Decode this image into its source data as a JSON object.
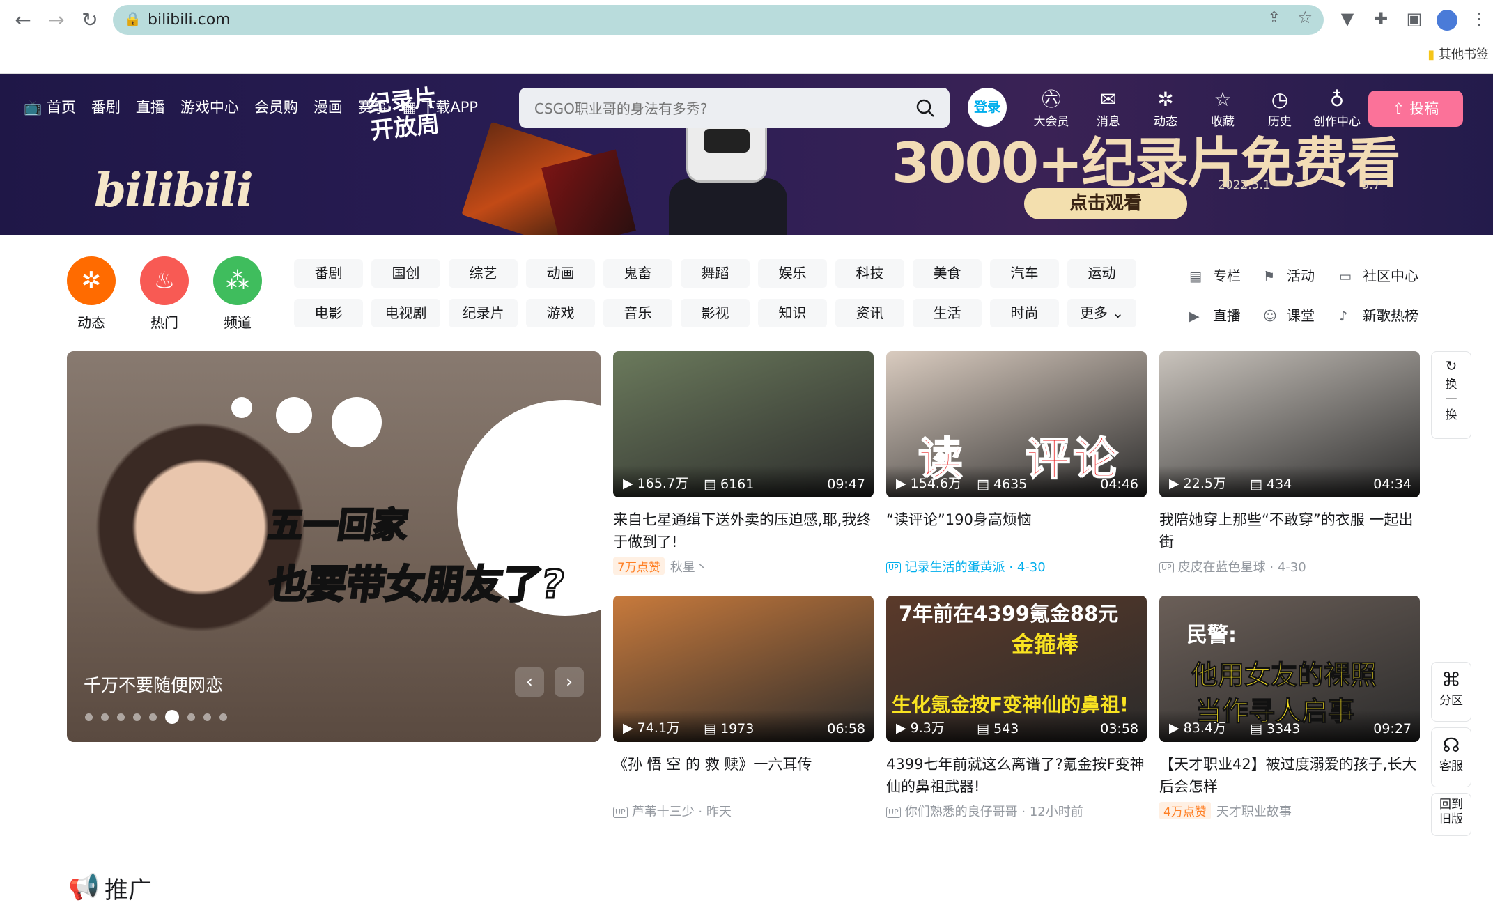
{
  "browser": {
    "url": "bilibili.com",
    "bookmark": "其他书签"
  },
  "header": {
    "nav": [
      "首页",
      "番剧",
      "直播",
      "游戏中心",
      "会员购",
      "漫画",
      "赛事",
      "下载APP"
    ],
    "search_placeholder": "CSGO职业哥的身法有多秀?",
    "login": "登录",
    "user_items": [
      "大会员",
      "消息",
      "动态",
      "收藏",
      "历史",
      "创作中心"
    ],
    "upload": "投稿"
  },
  "banner": {
    "logo": "bilibili",
    "subtitle": "纪录片\n开放周",
    "headline": "3000+纪录片免费看",
    "date_start": "2022.5.1",
    "date_end": "5.7",
    "cta": "点击观看"
  },
  "channels": {
    "shortcuts": [
      {
        "label": "动态",
        "color": "#ff6b00",
        "icon": "pinwheel-icon"
      },
      {
        "label": "热门",
        "color": "#f85a54",
        "icon": "fire-icon"
      },
      {
        "label": "频道",
        "color": "#3fbd5d",
        "icon": "channel-icon"
      }
    ],
    "row1": [
      "番剧",
      "国创",
      "综艺",
      "动画",
      "鬼畜",
      "舞蹈",
      "娱乐",
      "科技",
      "美食",
      "汽车",
      "运动"
    ],
    "row2": [
      "电影",
      "电视剧",
      "纪录片",
      "游戏",
      "音乐",
      "影视",
      "知识",
      "资讯",
      "生活",
      "时尚",
      "更多"
    ],
    "side_links": [
      "专栏",
      "活动",
      "社区中心",
      "直播",
      "课堂",
      "新歌热榜"
    ]
  },
  "carousel": {
    "caption": "千万不要随便网恋",
    "overlay_line1": "五一回家",
    "overlay_line2": "也要带女朋友了?",
    "active_index": 5,
    "dot_count": 9
  },
  "videos": [
    {
      "plays": "165.7万",
      "danmaku": "6161",
      "duration": "09:47",
      "title": "来自七星通缉下送外卖的压迫感,耶,我终于做到了!",
      "badge": "7万点赞",
      "author": "秋星丶",
      "date": "",
      "up_style": "likes",
      "thumb": "#6b7a5c"
    },
    {
      "plays": "154.6万",
      "danmaku": "4635",
      "duration": "04:46",
      "title": "“读评论”190身高烦恼",
      "badge": "",
      "author": "记录生活的蛋黄派",
      "date": "4-30",
      "up_style": "blue",
      "thumb": "#d9cbbf"
    },
    {
      "plays": "22.5万",
      "danmaku": "434",
      "duration": "04:34",
      "title": "我陪她穿上那些“不敢穿”的衣服 一起出街",
      "badge": "",
      "author": "皮皮在蓝色星球",
      "date": "4-30",
      "up_style": "up",
      "thumb": "#c9c3bc"
    },
    {
      "plays": "74.1万",
      "danmaku": "1973",
      "duration": "06:58",
      "title": "《孙 悟 空 的 救 赎》一六耳传",
      "badge": "",
      "author": "芦苇十三少",
      "date": "昨天",
      "up_style": "up",
      "thumb": "#c87a3c"
    },
    {
      "plays": "9.3万",
      "danmaku": "543",
      "duration": "03:58",
      "title": "4399七年前就这么离谱了?氪金按F变神仙的鼻祖武器!",
      "badge": "",
      "author": "你们熟悉的良仔哥哥",
      "date": "12小时前",
      "up_style": "up",
      "thumb": "#5b3a2a"
    },
    {
      "plays": "83.4万",
      "danmaku": "3343",
      "duration": "09:27",
      "title": "【天才职业42】被过度溺爱的孩子,长大后会怎样",
      "badge": "4万点赞",
      "author": "天才职业故事",
      "date": "",
      "up_style": "likes",
      "thumb": "#6b5f58"
    }
  ],
  "thumb_text": {
    "v1": "读 评论",
    "v4a": "7年前在4399氪金88元",
    "v4b": "金箍棒",
    "v4c": "生化氪金按F变神仙的鼻祖!",
    "v5a": "民警:",
    "v5b": "他用女友的裸照",
    "v5c": "当作寻人启事"
  },
  "floating": {
    "refresh": "换一换",
    "zones": "分区",
    "service": "客服",
    "old": "回到旧版"
  },
  "section": {
    "title": "推广"
  }
}
